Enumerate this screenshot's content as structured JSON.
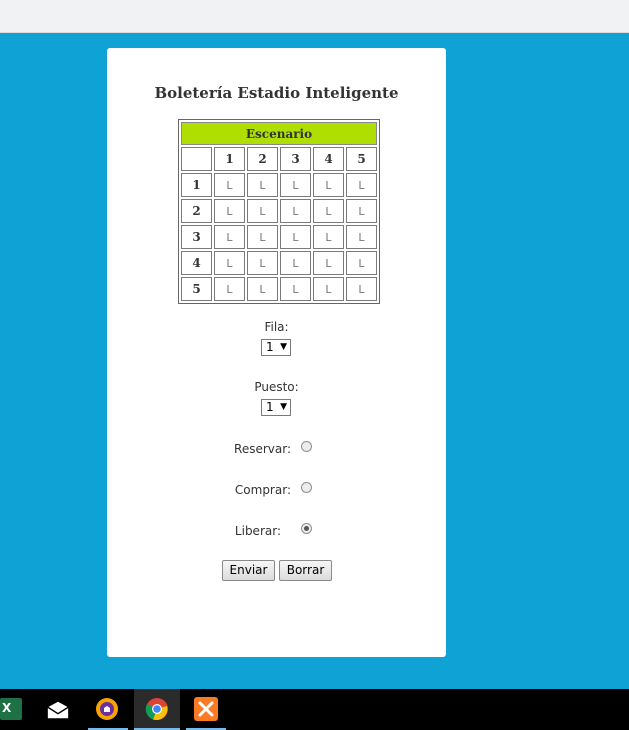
{
  "page": {
    "title": "Boletería Estadio Inteligente"
  },
  "grid": {
    "stage_label": "Escenario",
    "column_headers": [
      "1",
      "2",
      "3",
      "4",
      "5"
    ],
    "rows": [
      {
        "label": "1",
        "seats": [
          "L",
          "L",
          "L",
          "L",
          "L"
        ]
      },
      {
        "label": "2",
        "seats": [
          "L",
          "L",
          "L",
          "L",
          "L"
        ]
      },
      {
        "label": "3",
        "seats": [
          "L",
          "L",
          "L",
          "L",
          "L"
        ]
      },
      {
        "label": "4",
        "seats": [
          "L",
          "L",
          "L",
          "L",
          "L"
        ]
      },
      {
        "label": "5",
        "seats": [
          "L",
          "L",
          "L",
          "L",
          "L"
        ]
      }
    ]
  },
  "form": {
    "fila_label": "Fila:",
    "fila_value": "1",
    "puesto_label": "Puesto:",
    "puesto_value": "1",
    "reservar_label": "Reservar:",
    "comprar_label": "Comprar:",
    "liberar_label": "Liberar:",
    "selected_action": "Liberar",
    "enviar_label": "Enviar",
    "borrar_label": "Borrar"
  },
  "colors": {
    "background": "#0ea3d4",
    "stage": "#aedf00"
  },
  "taskbar": {
    "icons": [
      "excel-icon",
      "mail-icon",
      "vpn-shield-icon",
      "chrome-icon",
      "xampp-icon"
    ]
  }
}
